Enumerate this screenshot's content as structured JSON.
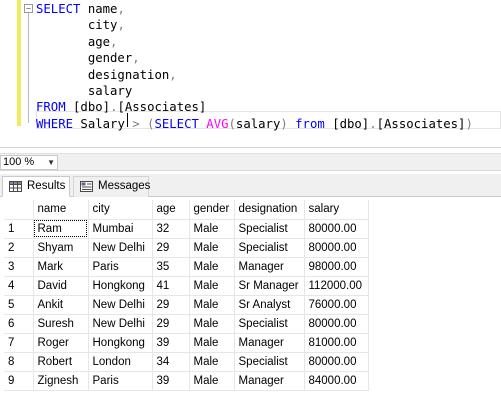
{
  "editor": {
    "lines": [
      [
        {
          "t": "SELECT ",
          "c": "kw"
        },
        {
          "t": "name",
          "c": ""
        },
        {
          "t": ",",
          "c": "op"
        }
      ],
      [
        {
          "t": "       city",
          "c": ""
        },
        {
          "t": ",",
          "c": "op"
        }
      ],
      [
        {
          "t": "       age",
          "c": ""
        },
        {
          "t": ",",
          "c": "op"
        }
      ],
      [
        {
          "t": "       gender",
          "c": ""
        },
        {
          "t": ",",
          "c": "op"
        }
      ],
      [
        {
          "t": "       designation",
          "c": ""
        },
        {
          "t": ",",
          "c": "op"
        }
      ],
      [
        {
          "t": "       salary",
          "c": ""
        }
      ],
      [
        {
          "t": "FROM ",
          "c": "kw"
        },
        {
          "t": "[dbo]",
          "c": ""
        },
        {
          "t": ".",
          "c": "op"
        },
        {
          "t": "[Associates]",
          "c": ""
        }
      ],
      [
        {
          "t": "WHERE ",
          "c": "kw"
        },
        {
          "t": "Salary ",
          "c": ""
        },
        {
          "t": "> ",
          "c": "op"
        },
        {
          "t": "(",
          "c": "op"
        },
        {
          "t": "SELECT ",
          "c": "kw"
        },
        {
          "t": "AVG",
          "c": "fn"
        },
        {
          "t": "(",
          "c": "op"
        },
        {
          "t": "salary",
          "c": ""
        },
        {
          "t": ") ",
          "c": "op"
        },
        {
          "t": "from ",
          "c": "kw"
        },
        {
          "t": "[dbo]",
          "c": ""
        },
        {
          "t": ".",
          "c": "op"
        },
        {
          "t": "[Associates]",
          "c": ""
        },
        {
          "t": ")",
          "c": "op"
        }
      ]
    ]
  },
  "zoom": {
    "value": "100 %"
  },
  "tabs": {
    "results": "Results",
    "messages": "Messages"
  },
  "grid": {
    "columns": [
      "name",
      "city",
      "age",
      "gender",
      "designation",
      "salary"
    ],
    "rows": [
      [
        "1",
        "Ram",
        "Mumbai",
        "32",
        "Male",
        "Specialist",
        "80000.00"
      ],
      [
        "2",
        "Shyam",
        "New Delhi",
        "29",
        "Male",
        "Specialist",
        "80000.00"
      ],
      [
        "3",
        "Mark",
        "Paris",
        "35",
        "Male",
        "Manager",
        "98000.00"
      ],
      [
        "4",
        "David",
        "Hongkong",
        "41",
        "Male",
        "Sr Manager",
        "112000.00"
      ],
      [
        "5",
        "Ankit",
        "New Delhi",
        "29",
        "Male",
        "Sr Analyst",
        "76000.00"
      ],
      [
        "6",
        "Suresh",
        "New Delhi",
        "29",
        "Male",
        "Specialist",
        "80000.00"
      ],
      [
        "7",
        "Roger",
        "Hongkong",
        "39",
        "Male",
        "Manager",
        "81000.00"
      ],
      [
        "8",
        "Robert",
        "London",
        "34",
        "Male",
        "Specialist",
        "80000.00"
      ],
      [
        "9",
        "Zignesh",
        "Paris",
        "39",
        "Male",
        "Manager",
        "84000.00"
      ]
    ]
  }
}
